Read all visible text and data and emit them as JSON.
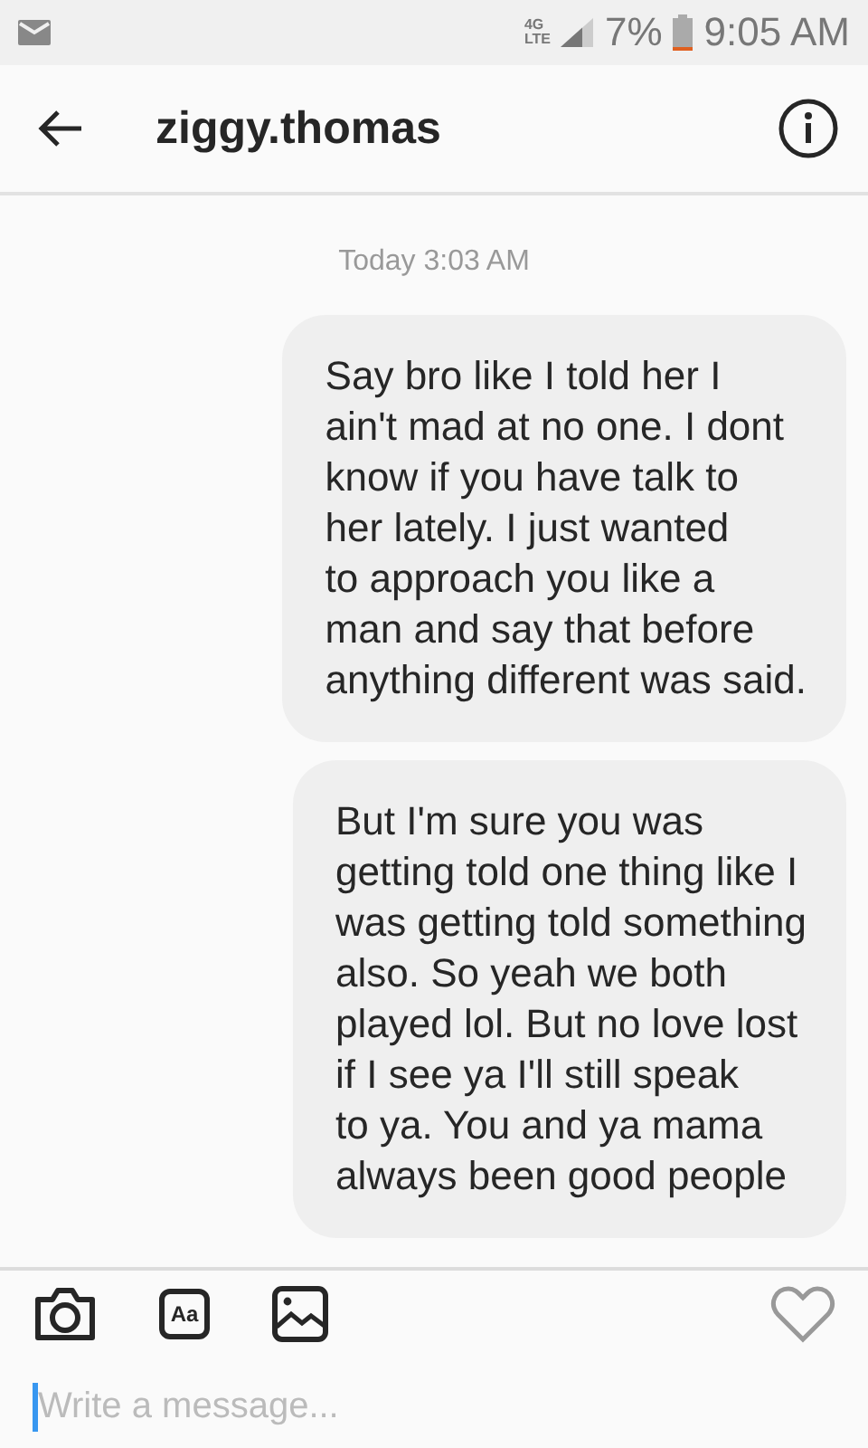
{
  "status_bar": {
    "network": "4G",
    "network_sub": "LTE",
    "battery": "7%",
    "time": "9:05 AM"
  },
  "header": {
    "title": "ziggy.thomas"
  },
  "timestamp": "Today 3:03 AM",
  "messages": [
    {
      "text": "Say bro like I told her I\nain't mad at no one. I dont\nknow if you have talk to\nher lately. I just wanted\nto approach you like a\nman and say that before\nanything different was said."
    },
    {
      "text": "But I'm sure you was\ngetting told one thing like I\nwas getting told something\nalso. So yeah we both\nplayed lol. But no love lost\nif  I see ya I'll still speak\nto ya. You and ya mama\nalways been good people"
    }
  ],
  "composer": {
    "text_style_label": "Aa",
    "placeholder": "Write a message..."
  }
}
